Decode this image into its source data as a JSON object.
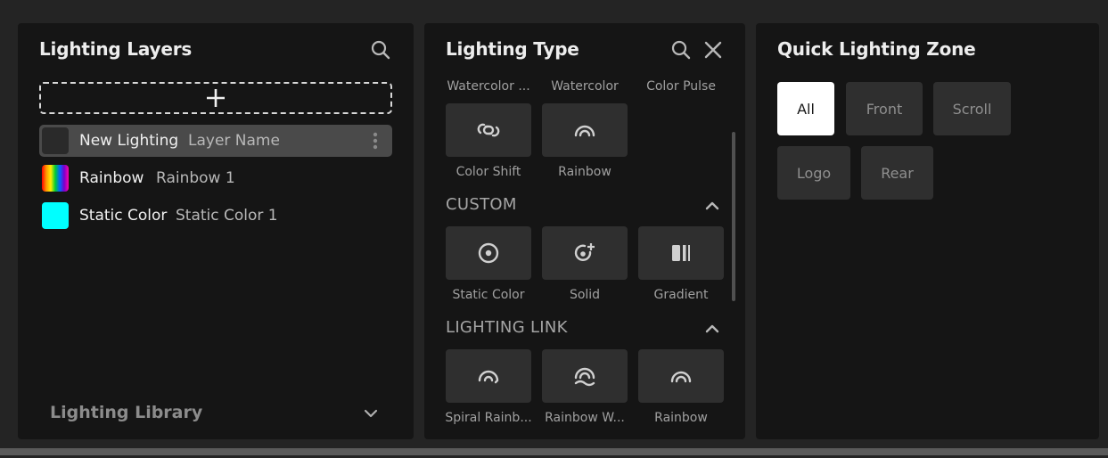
{
  "layers_panel": {
    "title": "Lighting Layers",
    "search_icon": "search-icon",
    "add_icon": "plus-icon",
    "layers": [
      {
        "type": "New Lighting",
        "name": "Layer Name",
        "swatch": "#2a2a2a",
        "selected": true
      },
      {
        "type": "Rainbow",
        "name": "Rainbow 1",
        "swatch": "rainbow",
        "selected": false
      },
      {
        "type": "Static Color",
        "name": "Static Color 1",
        "swatch": "#00ffff",
        "selected": false
      }
    ],
    "library_label": "Lighting Library"
  },
  "type_panel": {
    "title": "Lighting Type",
    "partial_row_labels": [
      "Watercolor ...",
      "Watercolor",
      "Color Pulse"
    ],
    "preset_tiles": [
      {
        "label": "Color Shift",
        "icon": "link-icon"
      },
      {
        "label": "Rainbow",
        "icon": "rainbow-icon"
      }
    ],
    "custom_section": {
      "title": "CUSTOM",
      "tiles": [
        {
          "label": "Static Color",
          "icon": "target-icon"
        },
        {
          "label": "Solid",
          "icon": "target-plus-icon"
        },
        {
          "label": "Gradient",
          "icon": "gradient-bars-icon"
        }
      ]
    },
    "link_section": {
      "title": "LIGHTING LINK",
      "tiles": [
        {
          "label": "Spiral Rainb...",
          "icon": "spiral-rainbow-icon"
        },
        {
          "label": "Rainbow W...",
          "icon": "rainbow-wave-icon"
        },
        {
          "label": "Rainbow",
          "icon": "rainbow-icon"
        }
      ]
    }
  },
  "zone_panel": {
    "title": "Quick Lighting Zone",
    "zones": [
      {
        "label": "All",
        "active": true
      },
      {
        "label": "Front",
        "active": false
      },
      {
        "label": "Scroll",
        "active": false
      },
      {
        "label": "Logo",
        "active": false
      },
      {
        "label": "Rear",
        "active": false
      }
    ]
  },
  "colors": {
    "background": "#242424",
    "panel": "#151515",
    "tile": "#2f2f2f",
    "selected_row": "#4a4a4a",
    "active_zone": "#ffffff"
  }
}
